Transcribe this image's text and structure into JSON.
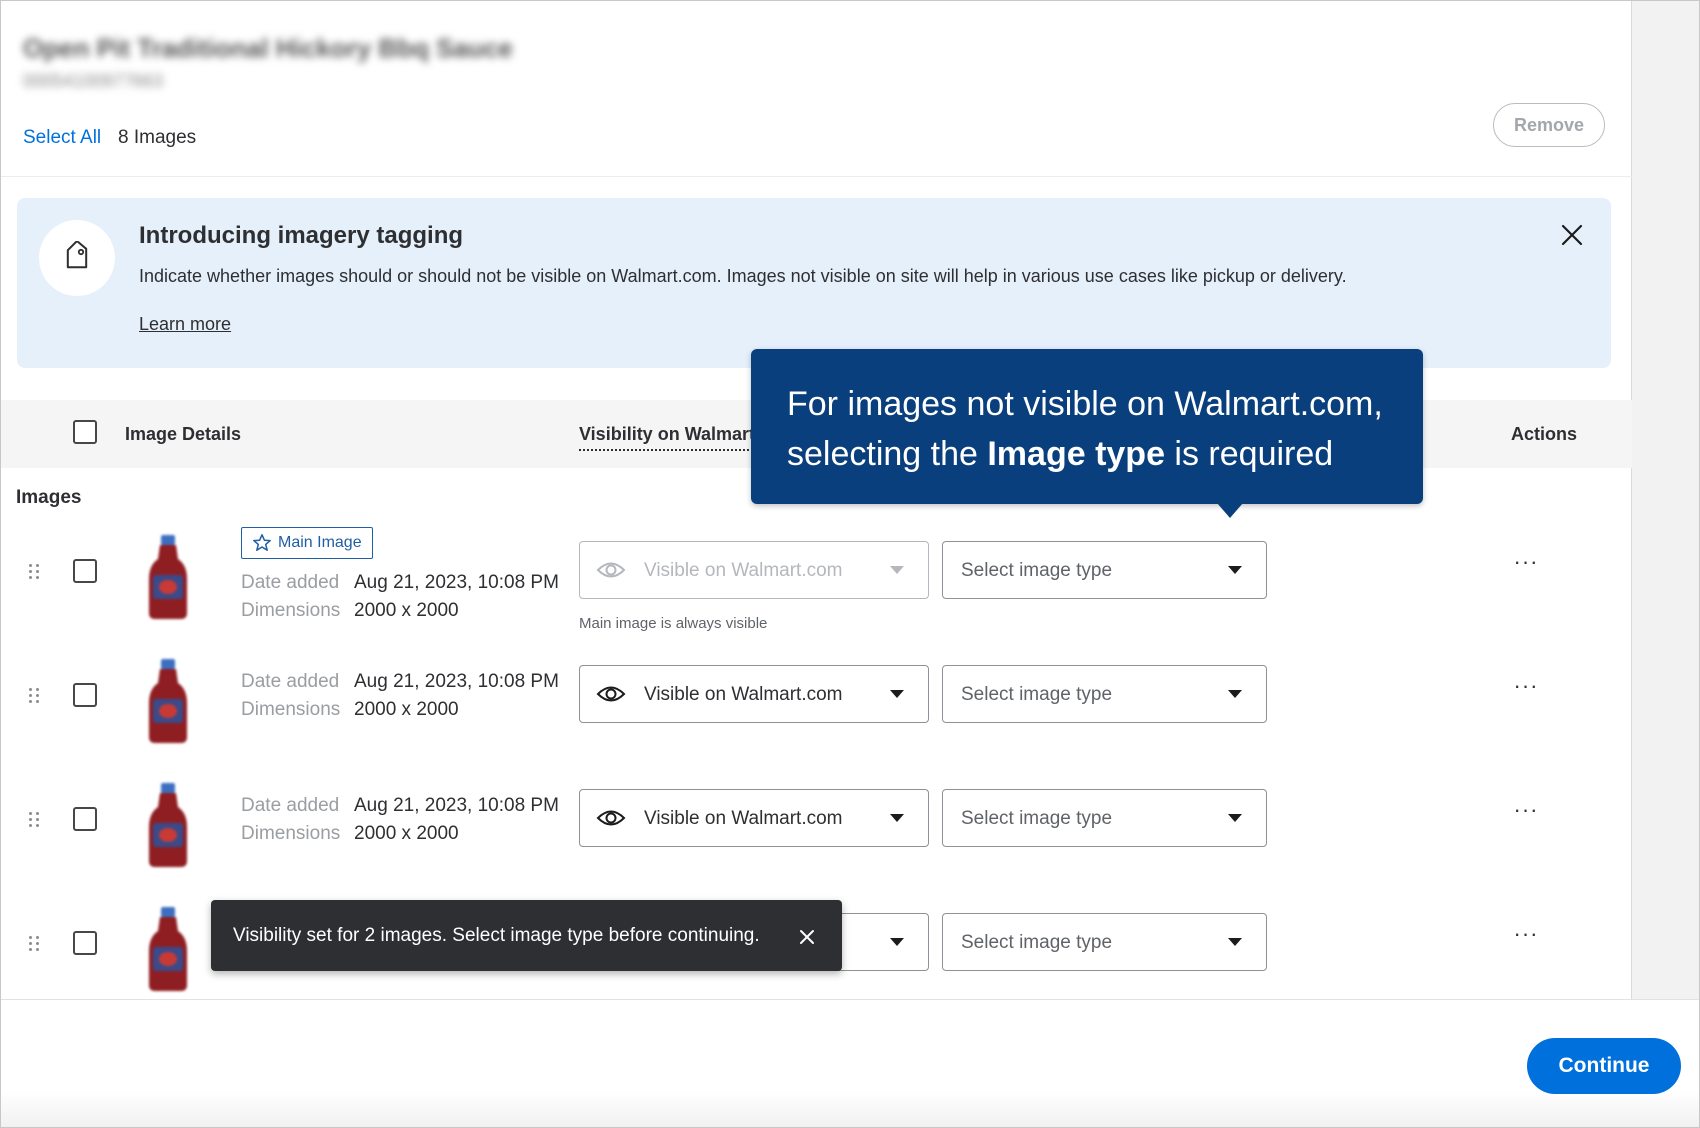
{
  "header": {
    "product_title": "Open Pit Traditional Hickory Bbq Sauce",
    "product_id": "00054100977663",
    "select_all": "Select All",
    "image_count": "8 Images",
    "remove_label": "Remove"
  },
  "banner": {
    "title": "Introducing imagery tagging",
    "text": "Indicate whether images should or should not be visible on Walmart.com. Images not visible on site will help in various use cases like pickup or delivery.",
    "link": "Learn more"
  },
  "table": {
    "headers": {
      "details": "Image Details",
      "visibility": "Visibility on Walmart.com",
      "actions": "Actions"
    },
    "section_label": "Images",
    "meta_labels": {
      "date_added": "Date added",
      "dimensions": "Dimensions"
    },
    "main_badge": "Main Image",
    "main_helper": "Main image is always visible",
    "more": "···",
    "rows": [
      {
        "date": "Aug 21, 2023, 10:08 PM",
        "dims": "2000 x 2000",
        "visibility": "Visible on Walmart.com",
        "type": "Select image type",
        "main": true
      },
      {
        "date": "Aug 21, 2023, 10:08 PM",
        "dims": "2000 x 2000",
        "visibility": "Visible on Walmart.com",
        "type": "Select image type",
        "main": false
      },
      {
        "date": "Aug 21, 2023, 10:08 PM",
        "dims": "2000 x 2000",
        "visibility": "Visible on Walmart.com",
        "type": "Select image type",
        "main": false
      },
      {
        "date": "",
        "dims": "",
        "visibility": "",
        "type": "Select image type",
        "main": false
      }
    ]
  },
  "tooltip": {
    "line1": "For images not visible on Walmart.com,",
    "line2_pre": "selecting the ",
    "line2_bold": "Image type",
    "line2_post": " is required"
  },
  "toast": {
    "text": "Visibility set for 2 images. Select image type before continuing."
  },
  "footer": {
    "continue_label": "Continue"
  },
  "colors": {
    "accent": "#0071dc",
    "tooltip_bg": "#0a3f7d",
    "banner_bg": "#e6f0fb",
    "toast_bg": "#2e2f32"
  }
}
